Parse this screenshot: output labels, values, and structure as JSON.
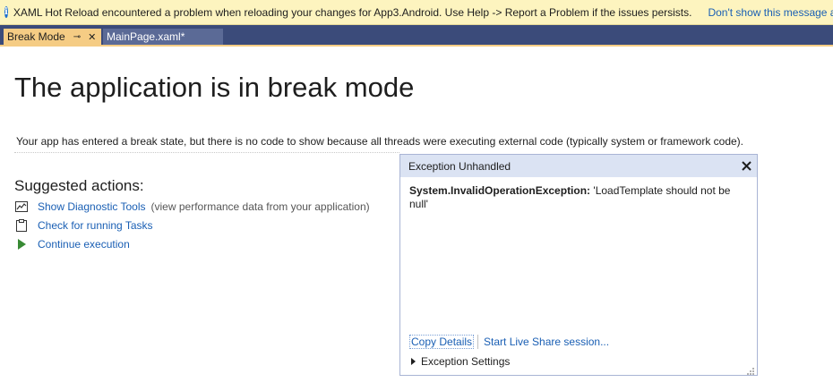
{
  "infobar": {
    "icon": "info-icon",
    "message": "XAML Hot Reload encountered a problem when reloading your changes for App3.Android. Use Help -> Report a Problem if the issues persists.",
    "link": "Don't show this message again"
  },
  "tabs": [
    {
      "label": "Break Mode",
      "pin": "⊸",
      "close": "✕"
    },
    {
      "label": "MainPage.xaml*"
    }
  ],
  "main": {
    "title": "The application is in break mode",
    "description": "Your app has entered a break state, but there is no code to show because all threads were executing external code (typically system or framework code).",
    "suggested_heading": "Suggested actions:",
    "actions": [
      {
        "label": "Show Diagnostic Tools",
        "note": "(view performance data from your application)",
        "icon": "diagnostic-tools-icon"
      },
      {
        "label": "Check for running Tasks",
        "icon": "clipboard-icon"
      },
      {
        "label": "Continue execution",
        "icon": "play-icon"
      }
    ]
  },
  "popup": {
    "title": "Exception Unhandled",
    "exception_type": "System.InvalidOperationException:",
    "exception_message": "'LoadTemplate should not be null'",
    "copy_details": "Copy Details",
    "live_share": "Start Live Share session...",
    "exception_settings": "Exception Settings"
  },
  "colors": {
    "infobar_bg": "#fdf4bf",
    "tab_active": "#f5cc84",
    "tabstrip_bg": "#3b4b7a",
    "link": "#1a5fb4",
    "popup_header": "#dbe3f3"
  }
}
